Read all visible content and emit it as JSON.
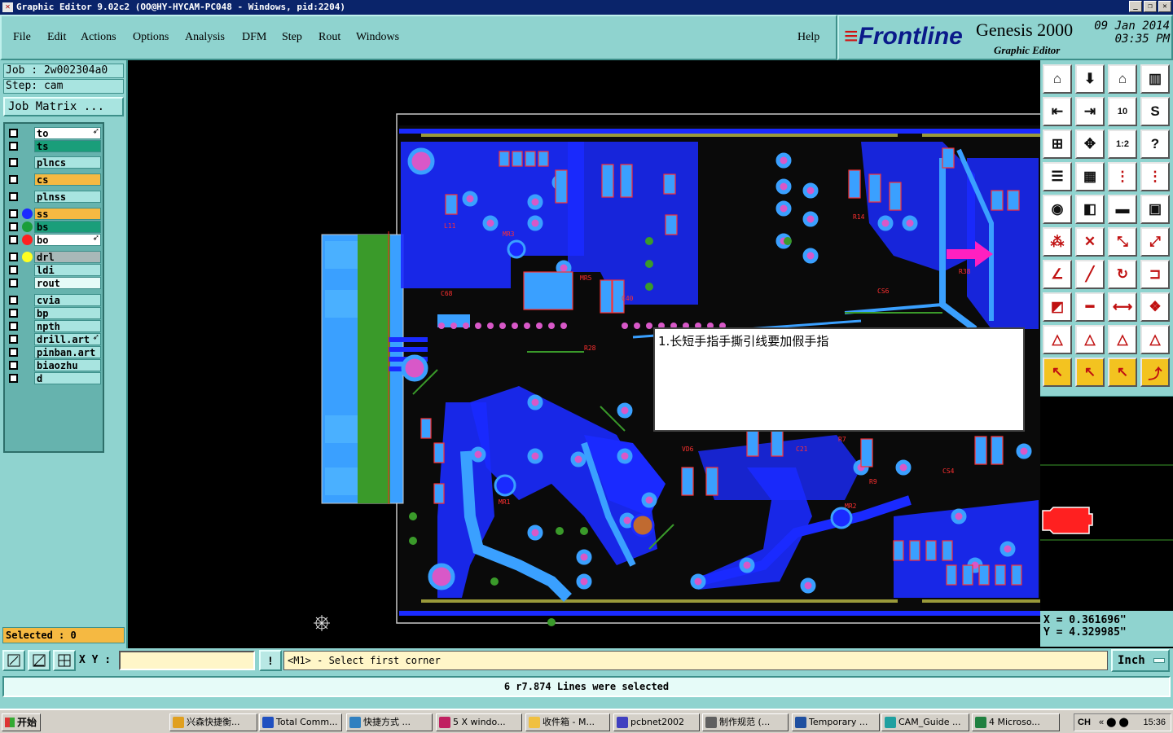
{
  "window": {
    "title": "Graphic Editor 9.02c2 (OO@HY-HYCAM-PC048 - Windows, pid:2204)"
  },
  "menu": {
    "items": [
      "File",
      "Edit",
      "Actions",
      "Options",
      "Analysis",
      "DFM",
      "Step",
      "Rout",
      "Windows"
    ],
    "help": "Help"
  },
  "brand": {
    "logo": "Frontline",
    "product": "Genesis 2000",
    "subtitle": "Graphic Editor",
    "date": "09 Jan 2014",
    "time": "03:35 PM"
  },
  "job": {
    "job_line": "Job : 2w002304a0",
    "step_line": "Step: cam",
    "matrix_button": "Job Matrix ..."
  },
  "layers": [
    {
      "name": "to",
      "color": "#ffffff",
      "dot": "",
      "arrow": true
    },
    {
      "name": "ts",
      "color": "#1a9e7a",
      "dot": "",
      "arrow": false
    },
    {
      "name": "plncs",
      "color": "#a8e4e0",
      "dot": "",
      "arrow": false
    },
    {
      "name": "cs",
      "color": "#f5b942",
      "dot": "",
      "arrow": false
    },
    {
      "name": "plnss",
      "color": "#a8e4e0",
      "dot": "",
      "arrow": false
    },
    {
      "name": "ss",
      "color": "#f5b942",
      "dot": "#1a2aff",
      "arrow": false
    },
    {
      "name": "bs",
      "color": "#1a9e7a",
      "dot": "#1a9e3a",
      "arrow": false
    },
    {
      "name": "bo",
      "color": "#ffffff",
      "dot": "#ff2020",
      "arrow": true
    },
    {
      "name": "drl",
      "color": "#a8b8b8",
      "dot": "#ffff20",
      "arrow": false
    },
    {
      "name": "ldi",
      "color": "#a8e4e0",
      "dot": "",
      "arrow": false
    },
    {
      "name": "rout",
      "color": "#e6fbf8",
      "dot": "",
      "arrow": false
    },
    {
      "name": "cvia",
      "color": "#a8e4e0",
      "dot": "",
      "arrow": false
    },
    {
      "name": "bp",
      "color": "#a8e4e0",
      "dot": "",
      "arrow": false
    },
    {
      "name": "npth",
      "color": "#a8e4e0",
      "dot": "",
      "arrow": false
    },
    {
      "name": "drill.art",
      "color": "#a8e4e0",
      "dot": "",
      "arrow": true
    },
    {
      "name": "pinban.art",
      "color": "#a8e4e0",
      "dot": "",
      "arrow": false
    },
    {
      "name": "biaozhu",
      "color": "#a8e4e0",
      "dot": "",
      "arrow": false
    },
    {
      "name": "d",
      "color": "#a8e4e0",
      "dot": "",
      "arrow": false
    }
  ],
  "selected_text": "Selected : 0",
  "note": "1.长短手指手撕引线要加假手指",
  "coords": {
    "x": "X = 0.361696\"",
    "y": "Y = 4.329985\""
  },
  "command": {
    "xy_label": "X Y :",
    "xy_value": "",
    "prompt": "<M1> - Select first corner",
    "unit": "Inch"
  },
  "status": "6 r7.874 Lines were selected",
  "taskbar": {
    "start": "开始",
    "tasks": [
      {
        "label": "兴森快捷衡...",
        "icon_color": "#e0a020"
      },
      {
        "label": "Total Comm...",
        "icon_color": "#2050c0"
      },
      {
        "label": "快捷方式 ...",
        "icon_color": "#3080c0"
      },
      {
        "label": "5 X windo...",
        "icon_color": "#c02060"
      },
      {
        "label": "收件箱 - M...",
        "icon_color": "#f0c040"
      },
      {
        "label": "pcbnet2002",
        "icon_color": "#4040c0"
      },
      {
        "label": "制作规范 (...",
        "icon_color": "#606060"
      },
      {
        "label": "Temporary ...",
        "icon_color": "#2050a0"
      },
      {
        "label": "CAM_Guide ...",
        "icon_color": "#20a0a0"
      },
      {
        "label": "4 Microso...",
        "icon_color": "#208040"
      }
    ],
    "lang": "CH",
    "clock": "15:36"
  }
}
